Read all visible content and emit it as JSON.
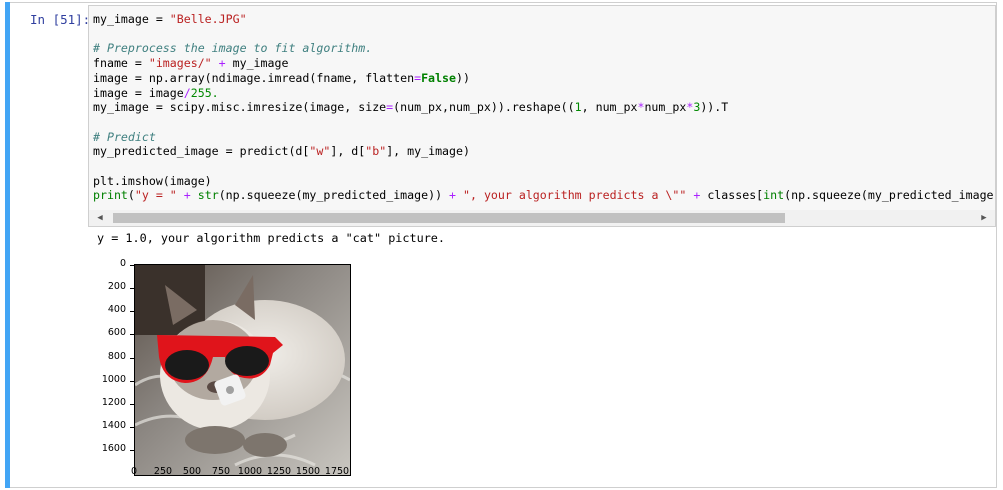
{
  "prompt": "In [51]:",
  "code_lines": [
    "my_image = \"Belle.JPG\"",
    "",
    "# Preprocess the image to fit algorithm.",
    "fname = \"images/\" + my_image",
    "image = np.array(ndimage.imread(fname, flatten=False))",
    "image = image/255.",
    "my_image = scipy.misc.imresize(image, size=(num_px,num_px)).reshape((1, num_px*num_px*3)).T",
    "",
    "# Predict",
    "my_predicted_image = predict(d[\"w\"], d[\"b\"], my_image)",
    "",
    "plt.imshow(image)",
    "print(\"y = \" + str(np.squeeze(my_predicted_image)) + \", your algorithm predicts a \\\"\" + classes[int(np.squeeze(my_predicted_image)"
  ],
  "output_text": "y = 1.0, your algorithm predicts a \"cat\" picture.",
  "plot": {
    "y_ticks": [
      "0",
      "200",
      "400",
      "600",
      "800",
      "1000",
      "1200",
      "1400",
      "1600"
    ],
    "x_ticks": [
      "0",
      "250",
      "500",
      "750",
      "1000",
      "1250",
      "1500",
      "1750"
    ],
    "image_description_icon": "cat-with-red-sunglasses-image"
  },
  "scrollbar": {
    "left_arrow": "◀",
    "right_arrow": "▶"
  },
  "colors": {
    "accent": "#42a5f5",
    "prompt": "#303f9f",
    "string": "#ba2121",
    "keyword": "#008000",
    "comment": "#408080",
    "operator": "#aa22ff"
  }
}
